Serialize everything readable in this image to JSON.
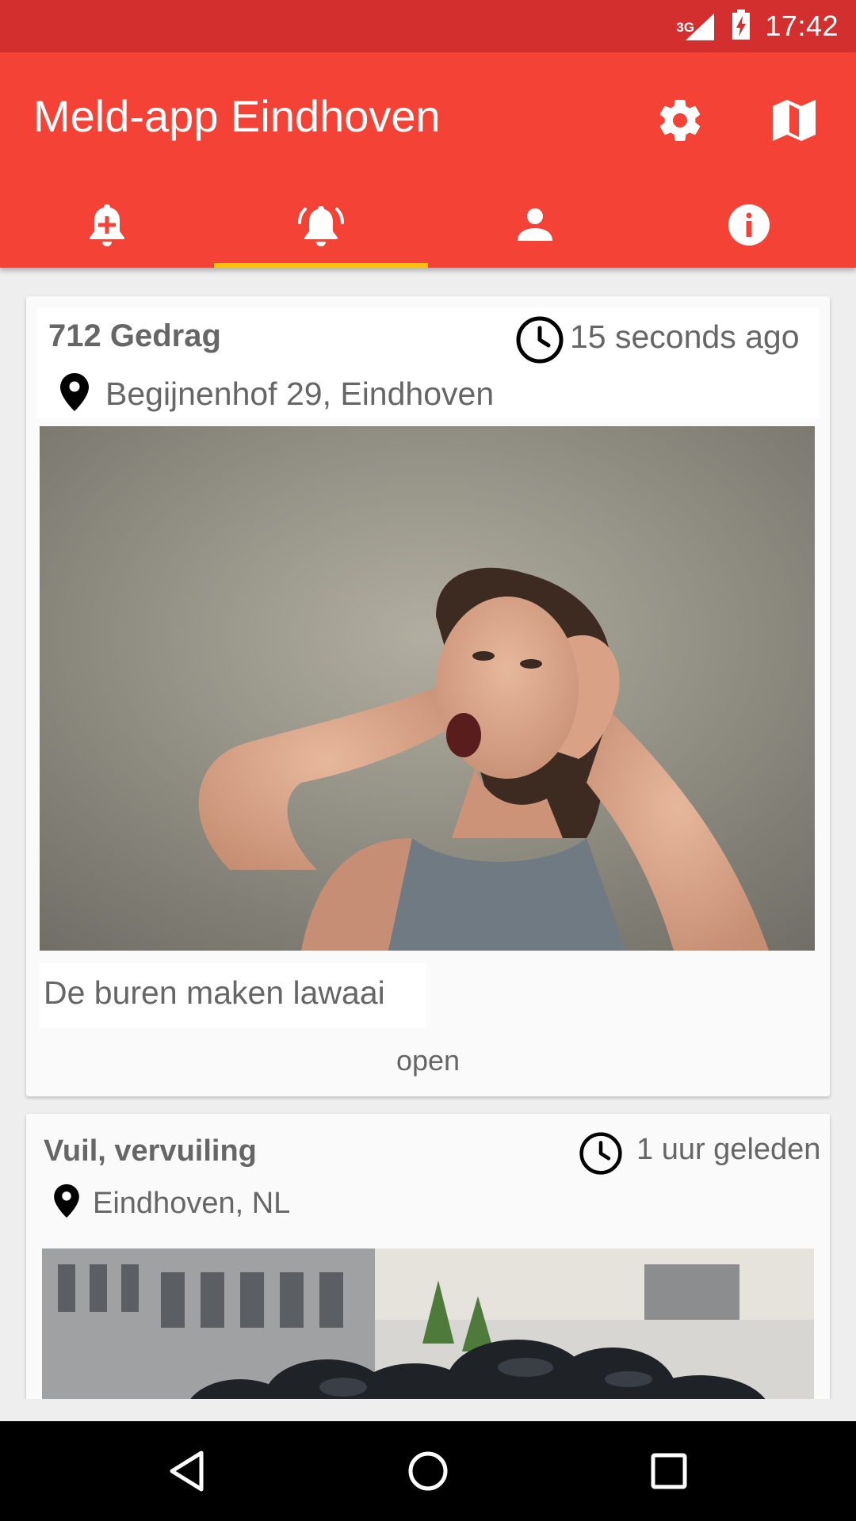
{
  "status_bar": {
    "network": "3G",
    "time": "17:42",
    "icons": [
      "signal-icon",
      "battery-charging-icon"
    ]
  },
  "app_bar": {
    "title": "Meld-app Eindhoven",
    "actions": [
      {
        "name": "settings",
        "icon": "gear-icon"
      },
      {
        "name": "map",
        "icon": "map-icon"
      }
    ]
  },
  "tabs": [
    {
      "name": "new-report",
      "icon": "bell-plus-icon",
      "active": false
    },
    {
      "name": "reports",
      "icon": "bell-ringing-icon",
      "active": true
    },
    {
      "name": "profile",
      "icon": "person-icon",
      "active": false
    },
    {
      "name": "info",
      "icon": "info-icon",
      "active": false
    }
  ],
  "reports": [
    {
      "title": "712 Gedrag",
      "time": "15 seconds ago",
      "location": "Begijnenhof 29, Eindhoven",
      "description": "De buren maken lawaai",
      "status": "open"
    },
    {
      "title": "Vuil, vervuiling",
      "time": "1 uur geleden",
      "location": "Eindhoven, NL"
    }
  ],
  "colors": {
    "status_bar": "#d32f2f",
    "primary": "#f44336",
    "tab_indicator": "#ffc107",
    "text_secondary": "#666666"
  }
}
